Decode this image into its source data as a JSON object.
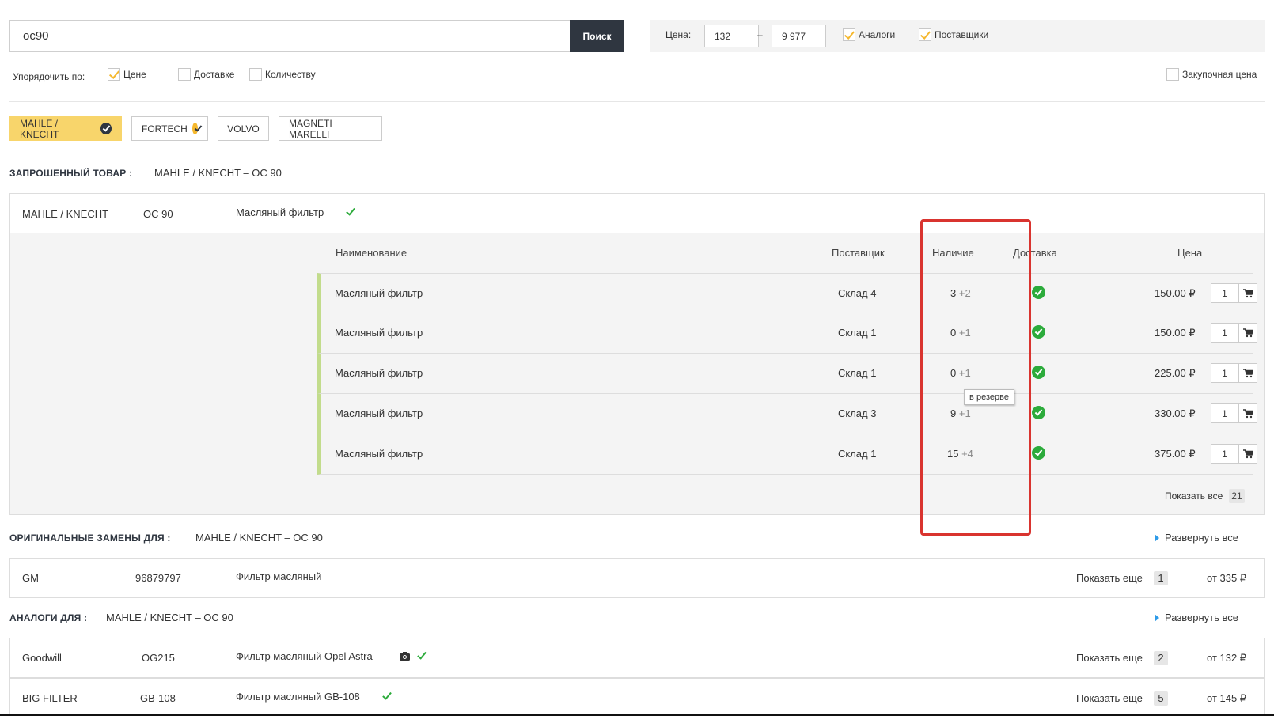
{
  "search": {
    "value": "oc90",
    "button": "Поиск"
  },
  "filters": {
    "price_label": "Цена:",
    "price_min": "132",
    "price_dash": "–",
    "price_max": "9 977",
    "analogs": {
      "label": "Аналоги",
      "checked": true
    },
    "suppliers": {
      "label": "Поставщики",
      "checked": true
    }
  },
  "sort": {
    "label": "Упорядочить по:",
    "options": [
      {
        "label": "Цене",
        "checked": true
      },
      {
        "label": "Доставке",
        "checked": false
      },
      {
        "label": "Количеству",
        "checked": false
      }
    ],
    "purchase_price": {
      "label": "Закупочная цена",
      "checked": false
    }
  },
  "brands": [
    {
      "label": "MAHLE / KNECHT",
      "active": true,
      "checked": true
    },
    {
      "label": "FORTECH",
      "active": false,
      "checked": true
    },
    {
      "label": "VOLVO",
      "active": false,
      "checked": false
    },
    {
      "label": "MAGNETI MARELLI",
      "active": false,
      "checked": false
    }
  ],
  "requested": {
    "title": "ЗАПРОШЕННЫЙ ТОВАР :",
    "subtitle": "MAHLE / KNECHT – OC 90",
    "brand": "MAHLE / KNECHT",
    "article": "OC 90",
    "name": "Масляный фильтр",
    "columns": {
      "name": "Наименование",
      "supplier": "Поставщик",
      "stock": "Наличие",
      "delivery": "Доставка",
      "price": "Цена"
    },
    "rows": [
      {
        "name": "Масляный фильтр",
        "supplier": "Склад 4",
        "stock": "3",
        "reserve": "+2",
        "price": "150.00 ₽",
        "qty": "1"
      },
      {
        "name": "Масляный фильтр",
        "supplier": "Склад 1",
        "stock": "0",
        "reserve": "+1",
        "price": "150.00 ₽",
        "qty": "1"
      },
      {
        "name": "Масляный фильтр",
        "supplier": "Склад 1",
        "stock": "0",
        "reserve": "+1",
        "price": "225.00 ₽",
        "qty": "1"
      },
      {
        "name": "Масляный фильтр",
        "supplier": "Склад 3",
        "stock": "9",
        "reserve": "+1",
        "price": "330.00 ₽",
        "qty": "1"
      },
      {
        "name": "Масляный фильтр",
        "supplier": "Склад 1",
        "stock": "15",
        "reserve": "+4",
        "price": "375.00 ₽",
        "qty": "1"
      }
    ],
    "tooltip": "в резерве",
    "show_all": "Показать все",
    "show_all_count": "21"
  },
  "originals": {
    "title": "ОРИГИНАЛЬНЫЕ ЗАМЕНЫ ДЛЯ :",
    "subtitle": "MAHLE / KNECHT – OC 90",
    "expand": "Развернуть все",
    "items": [
      {
        "brand": "GM",
        "article": "96879797",
        "name": "Фильтр масляный",
        "more": "Показать еще",
        "count": "1",
        "price": "от 335 ₽"
      }
    ]
  },
  "analogs": {
    "title": "АНАЛОГИ ДЛЯ :",
    "subtitle": "MAHLE / KNECHT – OC 90",
    "expand": "Развернуть все",
    "items": [
      {
        "brand": "Goodwill",
        "article": "OG215",
        "name": "Фильтр масляный Opel Astra",
        "more": "Показать еще",
        "count": "2",
        "price": "от 132 ₽"
      },
      {
        "brand": "BIG FILTER",
        "article": "GB-108",
        "name": "Фильтр масляный GB-108",
        "more": "Показать еще",
        "count": "5",
        "price": "от 145 ₽"
      }
    ]
  },
  "colors": {
    "accent": "#f8d56b",
    "dark": "#2f3640",
    "ok": "#2cab3b",
    "row_marker": "#c2dc8c",
    "highlight": "#d9342f",
    "link_arrow": "#2e9be8"
  }
}
